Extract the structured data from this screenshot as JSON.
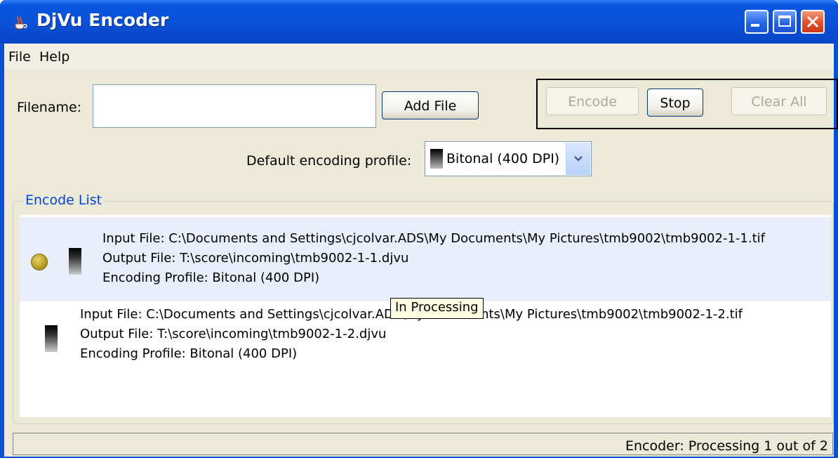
{
  "window": {
    "title": "DjVu Encoder",
    "icon": "java-cup-icon",
    "controls": [
      "minimize",
      "maximize",
      "close"
    ]
  },
  "menu": {
    "items": [
      "File",
      "Help"
    ]
  },
  "form": {
    "filename_label": "Filename:",
    "filename_value": "",
    "add_file_label": "Add File",
    "profile_label": "Default encoding profile:",
    "profile_selected": "Bitonal (400 DPI)"
  },
  "actions": {
    "encode_label": "Encode",
    "stop_label": "Stop",
    "clear_label": "Clear All"
  },
  "encode_list": {
    "title": "Encode List",
    "rows": [
      {
        "input": "Input File: C:\\Documents and Settings\\cjcolvar.ADS\\My Documents\\My Pictures\\tmb9002\\tmb9002-1-1.tif",
        "output": "Output File: T:\\score\\incoming\\tmb9002-1-1.djvu",
        "profile": "Encoding Profile: Bitonal (400 DPI)"
      },
      {
        "input": "Input File: C:\\Documents and Settings\\cjcolvar.ADS\\My Documents\\My Pictures\\tmb9002\\tmb9002-1-2.tif",
        "output": "Output File: T:\\score\\incoming\\tmb9002-1-2.djvu",
        "profile": "Encoding Profile: Bitonal (400 DPI)"
      }
    ]
  },
  "tooltip": "In Processing",
  "status": "Encoder: Processing 1 out of 2",
  "colors": {
    "titlebar": "#0a4fd6",
    "close_button": "#e14f2e",
    "group_title": "#0046d5",
    "selected_row": "#e8eefa",
    "status_dot": "#b69b1e"
  }
}
